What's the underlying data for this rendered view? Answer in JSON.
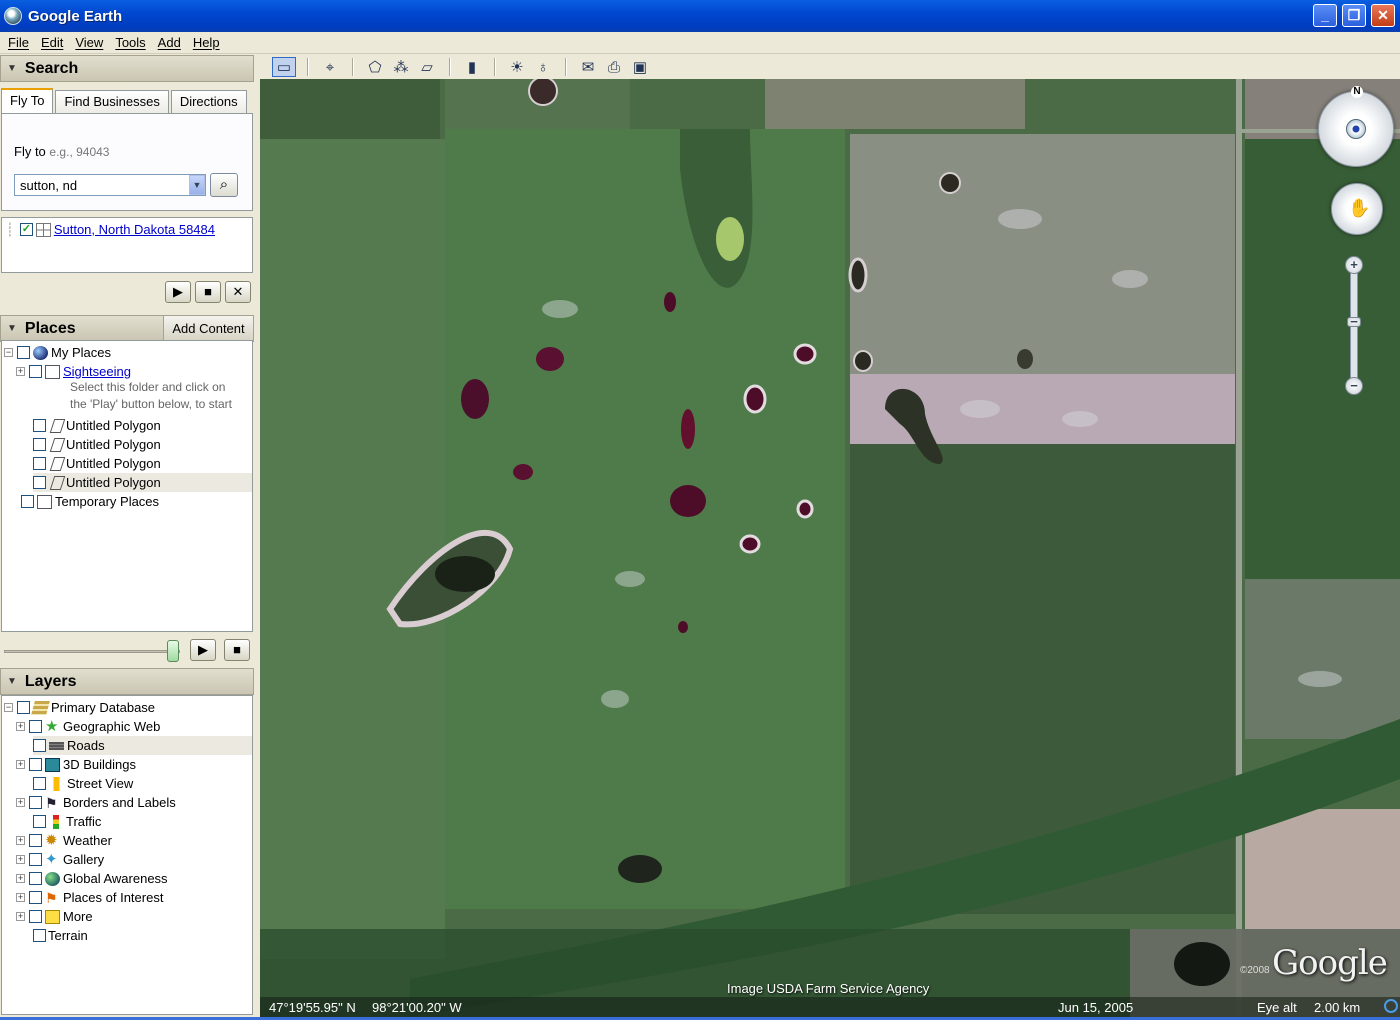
{
  "window": {
    "title": "Google Earth",
    "minimize": "_",
    "maximize": "❐",
    "close": "✕"
  },
  "menu": [
    "File",
    "Edit",
    "View",
    "Tools",
    "Add",
    "Help"
  ],
  "search": {
    "header": "Search",
    "tabs": [
      "Fly To",
      "Find Businesses",
      "Directions"
    ],
    "flyto_label": "Fly to",
    "flyto_hint": "e.g., 94043",
    "query": "sutton, nd",
    "result": "Sutton, North Dakota 58484"
  },
  "places": {
    "header": "Places",
    "add_content": "Add Content",
    "my_places": "My Places",
    "sightseeing": "Sightseeing",
    "sightseeing_desc_1": "Select this folder and click on",
    "sightseeing_desc_2": "the 'Play' button below, to start",
    "polygons": [
      "Untitled Polygon",
      "Untitled Polygon",
      "Untitled Polygon",
      "Untitled Polygon"
    ],
    "temporary": "Temporary Places"
  },
  "layers": {
    "header": "Layers",
    "primary": "Primary Database",
    "items": [
      "Geographic Web",
      "Roads",
      "3D Buildings",
      "Street View",
      "Borders and Labels",
      "Traffic",
      "Weather",
      "Gallery",
      "Global Awareness",
      "Places of Interest",
      "More"
    ],
    "terrain": "Terrain"
  },
  "map": {
    "credit": "Image USDA Farm Service Agency",
    "lat": "47°19'55.95\" N",
    "lon": "98°21'00.20\" W",
    "date": "Jun 15, 2005",
    "eye_alt_label": "Eye alt",
    "eye_alt": "2.00 km",
    "logo": "Google",
    "copyright": "©2008",
    "north": "N"
  },
  "icons": {
    "play": "▶",
    "stop": "■",
    "close": "✕",
    "search": "⌕",
    "dropdown": "▼",
    "collapse": "▼"
  }
}
